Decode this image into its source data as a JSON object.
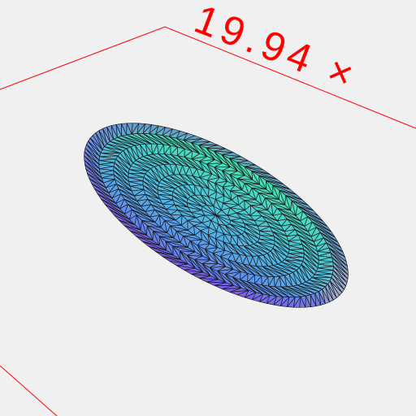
{
  "viewport": {
    "background": "#f0f0f0"
  },
  "annotation": {
    "dimension_label": "19.94 ×",
    "line_color": "#ff0000"
  },
  "mesh": {
    "shape": "ellipsoid",
    "style": "triangulated-wireframe",
    "edge_color": "#1a1a1a",
    "color_gradient": [
      "#46ecb0",
      "#4fb5e6",
      "#6a72f0",
      "#9c33ea",
      "#c7c7c7"
    ]
  }
}
